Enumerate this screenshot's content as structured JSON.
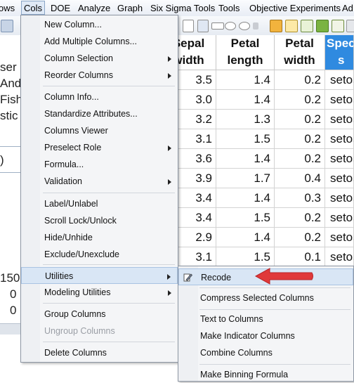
{
  "menubar": {
    "items": [
      {
        "label": "ows"
      },
      {
        "label": "Cols"
      },
      {
        "label": "DOE"
      },
      {
        "label": "Analyze"
      },
      {
        "label": "Graph"
      },
      {
        "label": "Six Sigma Tools"
      },
      {
        "label": "Tools"
      },
      {
        "label": "Objective Experiments"
      },
      {
        "label": "Ad"
      }
    ]
  },
  "left_panel": {
    "lines": [
      "ser",
      "And",
      "Fish",
      "stic",
      ")"
    ],
    "bottom_values": [
      "150",
      "0",
      "0"
    ]
  },
  "table": {
    "columns": [
      {
        "line1": "Sepal",
        "line2": "width"
      },
      {
        "line1": "Petal",
        "line2": "length"
      },
      {
        "line1": "Petal",
        "line2": "width"
      },
      {
        "line1": "Speci",
        "line2": "s"
      }
    ],
    "rows": [
      [
        "3.5",
        "1.4",
        "0.2",
        "setos"
      ],
      [
        "3.0",
        "1.4",
        "0.2",
        "setos"
      ],
      [
        "3.2",
        "1.3",
        "0.2",
        "setos"
      ],
      [
        "3.1",
        "1.5",
        "0.2",
        "setos"
      ],
      [
        "3.6",
        "1.4",
        "0.2",
        "setos"
      ],
      [
        "3.9",
        "1.7",
        "0.4",
        "setos"
      ],
      [
        "3.4",
        "1.4",
        "0.3",
        "setos"
      ],
      [
        "3.4",
        "1.5",
        "0.2",
        "setos"
      ],
      [
        "2.9",
        "1.4",
        "0.2",
        "setos"
      ],
      [
        "3.1",
        "1.5",
        "0.1",
        "setos"
      ]
    ]
  },
  "cols_menu": {
    "items": [
      {
        "label": "New Column...",
        "submenu": false,
        "disabled": false
      },
      {
        "label": "Add Multiple Columns...",
        "submenu": false,
        "disabled": false
      },
      {
        "label": "Column Selection",
        "submenu": true,
        "disabled": false
      },
      {
        "label": "Reorder Columns",
        "submenu": true,
        "disabled": false
      },
      {
        "label": "Column Info...",
        "submenu": false,
        "disabled": false
      },
      {
        "label": "Standardize Attributes...",
        "submenu": false,
        "disabled": false
      },
      {
        "label": "Columns Viewer",
        "submenu": false,
        "disabled": false
      },
      {
        "label": "Preselect Role",
        "submenu": true,
        "disabled": false
      },
      {
        "label": "Formula...",
        "submenu": false,
        "disabled": false
      },
      {
        "label": "Validation",
        "submenu": true,
        "disabled": false
      },
      {
        "label": "Label/Unlabel",
        "submenu": false,
        "disabled": false
      },
      {
        "label": "Scroll Lock/Unlock",
        "submenu": false,
        "disabled": false
      },
      {
        "label": "Hide/Unhide",
        "submenu": false,
        "disabled": false
      },
      {
        "label": "Exclude/Unexclude",
        "submenu": false,
        "disabled": false
      },
      {
        "label": "Utilities",
        "submenu": true,
        "disabled": false,
        "highlighted": true
      },
      {
        "label": "Modeling Utilities",
        "submenu": true,
        "disabled": false
      },
      {
        "label": "Group Columns",
        "submenu": false,
        "disabled": false
      },
      {
        "label": "Ungroup Columns",
        "submenu": false,
        "disabled": true
      },
      {
        "label": "Delete Columns",
        "submenu": false,
        "disabled": false
      }
    ]
  },
  "utilities_submenu": {
    "items": [
      {
        "label": "Recode",
        "icon": "recode-icon",
        "highlighted": true
      },
      {
        "label": "Compress Selected Columns"
      },
      {
        "label": "Text to Columns"
      },
      {
        "label": "Make Indicator Columns"
      },
      {
        "label": "Combine Columns"
      },
      {
        "label": "Make Binning Formula"
      }
    ]
  },
  "colors": {
    "selected_column_header": "#2f8ae0",
    "menu_highlight": "#d9e6f5",
    "annotation_arrow": "#e0393a"
  }
}
